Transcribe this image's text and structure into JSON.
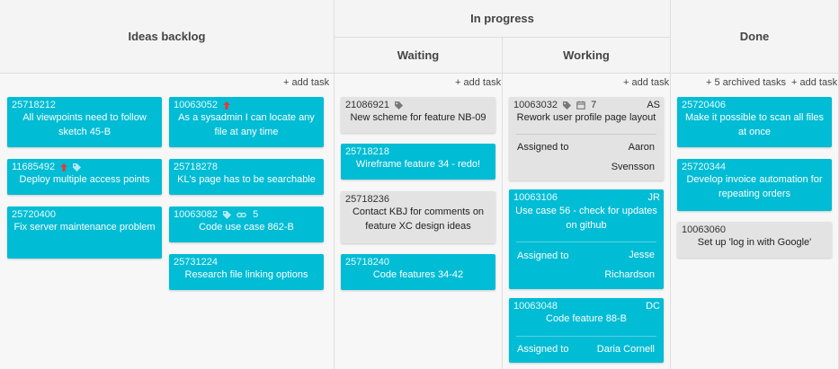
{
  "columns": {
    "ideas_backlog": "Ideas backlog",
    "in_progress": "In progress",
    "waiting": "Waiting",
    "working": "Working",
    "done": "Done"
  },
  "actions": {
    "add_task": "+ add task",
    "archived_tasks": "+ 5 archived tasks"
  },
  "assigned_label": "Assigned to",
  "colors": {
    "card_blue": "#00bcd4",
    "card_grey": "#e3e3e3",
    "priority_arrow": "#e53935"
  },
  "backlog_left": [
    {
      "id": "25718212",
      "title": "All viewpoints need to follow sketch 45-B"
    },
    {
      "id": "11685492",
      "title": "Deploy multiple access points",
      "icons": [
        "priority-up-icon",
        "tag-icon"
      ]
    },
    {
      "id": "25720400",
      "title": "Fix server maintenance problem"
    }
  ],
  "backlog_right": [
    {
      "id": "10063052",
      "title": "As a sysadmin I can locate any file at any time",
      "icons": [
        "priority-up-icon"
      ]
    },
    {
      "id": "25718278",
      "title": "KL's page has to be searchable"
    },
    {
      "id": "10063082",
      "title": "Code use case 862-B",
      "icons": [
        "tag-icon",
        "link-icon"
      ],
      "link_count": "5"
    },
    {
      "id": "25731224",
      "title": "Research file linking options"
    }
  ],
  "waiting": [
    {
      "id": "21086921",
      "title": "New scheme for feature NB-09",
      "icons": [
        "tag-icon"
      ]
    },
    {
      "id": "25718218",
      "title": "Wireframe feature 34 - redo!"
    },
    {
      "id": "25718236",
      "title": "Contact KBJ for comments on feature XC design ideas"
    },
    {
      "id": "25718240",
      "title": "Code features 34-42"
    }
  ],
  "working": [
    {
      "id": "10063032",
      "title": "Rework user profile page layout",
      "icons": [
        "tag-icon",
        "calendar-icon"
      ],
      "count": "7",
      "initials": "AS",
      "assignee_first": "Aaron",
      "assignee_last": "Svensson"
    },
    {
      "id": "10063106",
      "title": "Use case 56 - check for updates on github",
      "initials": "JR",
      "assignee_first": "Jesse",
      "assignee_last": "Richardson"
    },
    {
      "id": "10063048",
      "title": "Code feature 88-B",
      "initials": "DC",
      "assignee_full": "Daria Cornell"
    }
  ],
  "done": [
    {
      "id": "25720406",
      "title": "Make it possible to scan all files at once"
    },
    {
      "id": "25720344",
      "title": "Develop invoice automation for repeating orders"
    },
    {
      "id": "10063060",
      "title": "Set up 'log in with Google'"
    }
  ]
}
